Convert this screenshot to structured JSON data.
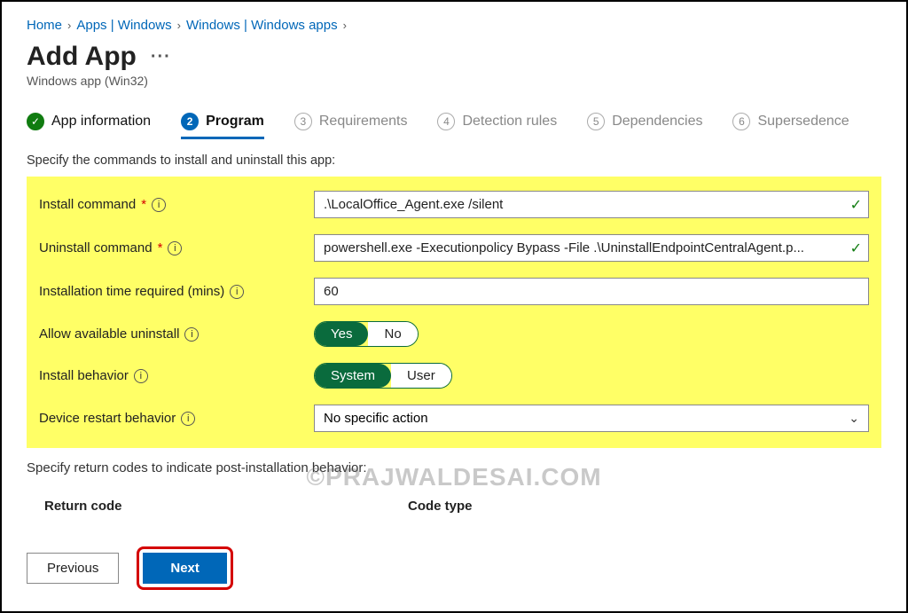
{
  "breadcrumb": {
    "items": [
      "Home",
      "Apps | Windows",
      "Windows | Windows apps"
    ]
  },
  "page": {
    "title": "Add App",
    "subtitle": "Windows app (Win32)"
  },
  "wizard": {
    "step1": "App information",
    "step2": "Program",
    "step3": "Requirements",
    "step4": "Detection rules",
    "step5": "Dependencies",
    "step6": "Supersedence"
  },
  "instructions": {
    "top": "Specify the commands to install and uninstall this app:",
    "bottom": "Specify return codes to indicate post-installation behavior:"
  },
  "labels": {
    "install_cmd": "Install command",
    "uninstall_cmd": "Uninstall command",
    "install_time": "Installation time required (mins)",
    "allow_uninstall": "Allow available uninstall",
    "install_behavior": "Install behavior",
    "restart_behavior": "Device restart behavior",
    "return_code": "Return code",
    "code_type": "Code type"
  },
  "values": {
    "install_cmd": ".\\LocalOffice_Agent.exe /silent",
    "uninstall_cmd": "powershell.exe -Executionpolicy Bypass -File .\\UninstallEndpointCentralAgent.p...",
    "install_time": "60",
    "allow_uninstall_yes": "Yes",
    "allow_uninstall_no": "No",
    "install_behavior_system": "System",
    "install_behavior_user": "User",
    "restart_behavior": "No specific action"
  },
  "buttons": {
    "previous": "Previous",
    "next": "Next"
  },
  "watermark": "©PRAJWALDESAI.COM"
}
